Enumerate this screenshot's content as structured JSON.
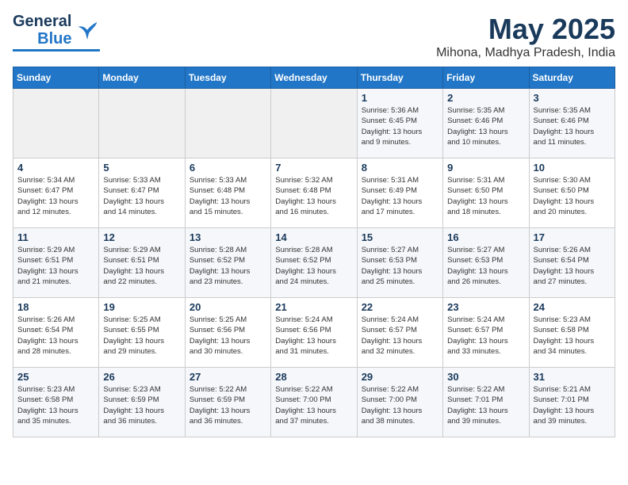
{
  "header": {
    "logo_line1": "General",
    "logo_line2": "Blue",
    "month_year": "May 2025",
    "location": "Mihona, Madhya Pradesh, India"
  },
  "weekdays": [
    "Sunday",
    "Monday",
    "Tuesday",
    "Wednesday",
    "Thursday",
    "Friday",
    "Saturday"
  ],
  "weeks": [
    [
      {
        "day": "",
        "info": ""
      },
      {
        "day": "",
        "info": ""
      },
      {
        "day": "",
        "info": ""
      },
      {
        "day": "",
        "info": ""
      },
      {
        "day": "1",
        "info": "Sunrise: 5:36 AM\nSunset: 6:45 PM\nDaylight: 13 hours\nand 9 minutes."
      },
      {
        "day": "2",
        "info": "Sunrise: 5:35 AM\nSunset: 6:46 PM\nDaylight: 13 hours\nand 10 minutes."
      },
      {
        "day": "3",
        "info": "Sunrise: 5:35 AM\nSunset: 6:46 PM\nDaylight: 13 hours\nand 11 minutes."
      }
    ],
    [
      {
        "day": "4",
        "info": "Sunrise: 5:34 AM\nSunset: 6:47 PM\nDaylight: 13 hours\nand 12 minutes."
      },
      {
        "day": "5",
        "info": "Sunrise: 5:33 AM\nSunset: 6:47 PM\nDaylight: 13 hours\nand 14 minutes."
      },
      {
        "day": "6",
        "info": "Sunrise: 5:33 AM\nSunset: 6:48 PM\nDaylight: 13 hours\nand 15 minutes."
      },
      {
        "day": "7",
        "info": "Sunrise: 5:32 AM\nSunset: 6:48 PM\nDaylight: 13 hours\nand 16 minutes."
      },
      {
        "day": "8",
        "info": "Sunrise: 5:31 AM\nSunset: 6:49 PM\nDaylight: 13 hours\nand 17 minutes."
      },
      {
        "day": "9",
        "info": "Sunrise: 5:31 AM\nSunset: 6:50 PM\nDaylight: 13 hours\nand 18 minutes."
      },
      {
        "day": "10",
        "info": "Sunrise: 5:30 AM\nSunset: 6:50 PM\nDaylight: 13 hours\nand 20 minutes."
      }
    ],
    [
      {
        "day": "11",
        "info": "Sunrise: 5:29 AM\nSunset: 6:51 PM\nDaylight: 13 hours\nand 21 minutes."
      },
      {
        "day": "12",
        "info": "Sunrise: 5:29 AM\nSunset: 6:51 PM\nDaylight: 13 hours\nand 22 minutes."
      },
      {
        "day": "13",
        "info": "Sunrise: 5:28 AM\nSunset: 6:52 PM\nDaylight: 13 hours\nand 23 minutes."
      },
      {
        "day": "14",
        "info": "Sunrise: 5:28 AM\nSunset: 6:52 PM\nDaylight: 13 hours\nand 24 minutes."
      },
      {
        "day": "15",
        "info": "Sunrise: 5:27 AM\nSunset: 6:53 PM\nDaylight: 13 hours\nand 25 minutes."
      },
      {
        "day": "16",
        "info": "Sunrise: 5:27 AM\nSunset: 6:53 PM\nDaylight: 13 hours\nand 26 minutes."
      },
      {
        "day": "17",
        "info": "Sunrise: 5:26 AM\nSunset: 6:54 PM\nDaylight: 13 hours\nand 27 minutes."
      }
    ],
    [
      {
        "day": "18",
        "info": "Sunrise: 5:26 AM\nSunset: 6:54 PM\nDaylight: 13 hours\nand 28 minutes."
      },
      {
        "day": "19",
        "info": "Sunrise: 5:25 AM\nSunset: 6:55 PM\nDaylight: 13 hours\nand 29 minutes."
      },
      {
        "day": "20",
        "info": "Sunrise: 5:25 AM\nSunset: 6:56 PM\nDaylight: 13 hours\nand 30 minutes."
      },
      {
        "day": "21",
        "info": "Sunrise: 5:24 AM\nSunset: 6:56 PM\nDaylight: 13 hours\nand 31 minutes."
      },
      {
        "day": "22",
        "info": "Sunrise: 5:24 AM\nSunset: 6:57 PM\nDaylight: 13 hours\nand 32 minutes."
      },
      {
        "day": "23",
        "info": "Sunrise: 5:24 AM\nSunset: 6:57 PM\nDaylight: 13 hours\nand 33 minutes."
      },
      {
        "day": "24",
        "info": "Sunrise: 5:23 AM\nSunset: 6:58 PM\nDaylight: 13 hours\nand 34 minutes."
      }
    ],
    [
      {
        "day": "25",
        "info": "Sunrise: 5:23 AM\nSunset: 6:58 PM\nDaylight: 13 hours\nand 35 minutes."
      },
      {
        "day": "26",
        "info": "Sunrise: 5:23 AM\nSunset: 6:59 PM\nDaylight: 13 hours\nand 36 minutes."
      },
      {
        "day": "27",
        "info": "Sunrise: 5:22 AM\nSunset: 6:59 PM\nDaylight: 13 hours\nand 36 minutes."
      },
      {
        "day": "28",
        "info": "Sunrise: 5:22 AM\nSunset: 7:00 PM\nDaylight: 13 hours\nand 37 minutes."
      },
      {
        "day": "29",
        "info": "Sunrise: 5:22 AM\nSunset: 7:00 PM\nDaylight: 13 hours\nand 38 minutes."
      },
      {
        "day": "30",
        "info": "Sunrise: 5:22 AM\nSunset: 7:01 PM\nDaylight: 13 hours\nand 39 minutes."
      },
      {
        "day": "31",
        "info": "Sunrise: 5:21 AM\nSunset: 7:01 PM\nDaylight: 13 hours\nand 39 minutes."
      }
    ]
  ]
}
